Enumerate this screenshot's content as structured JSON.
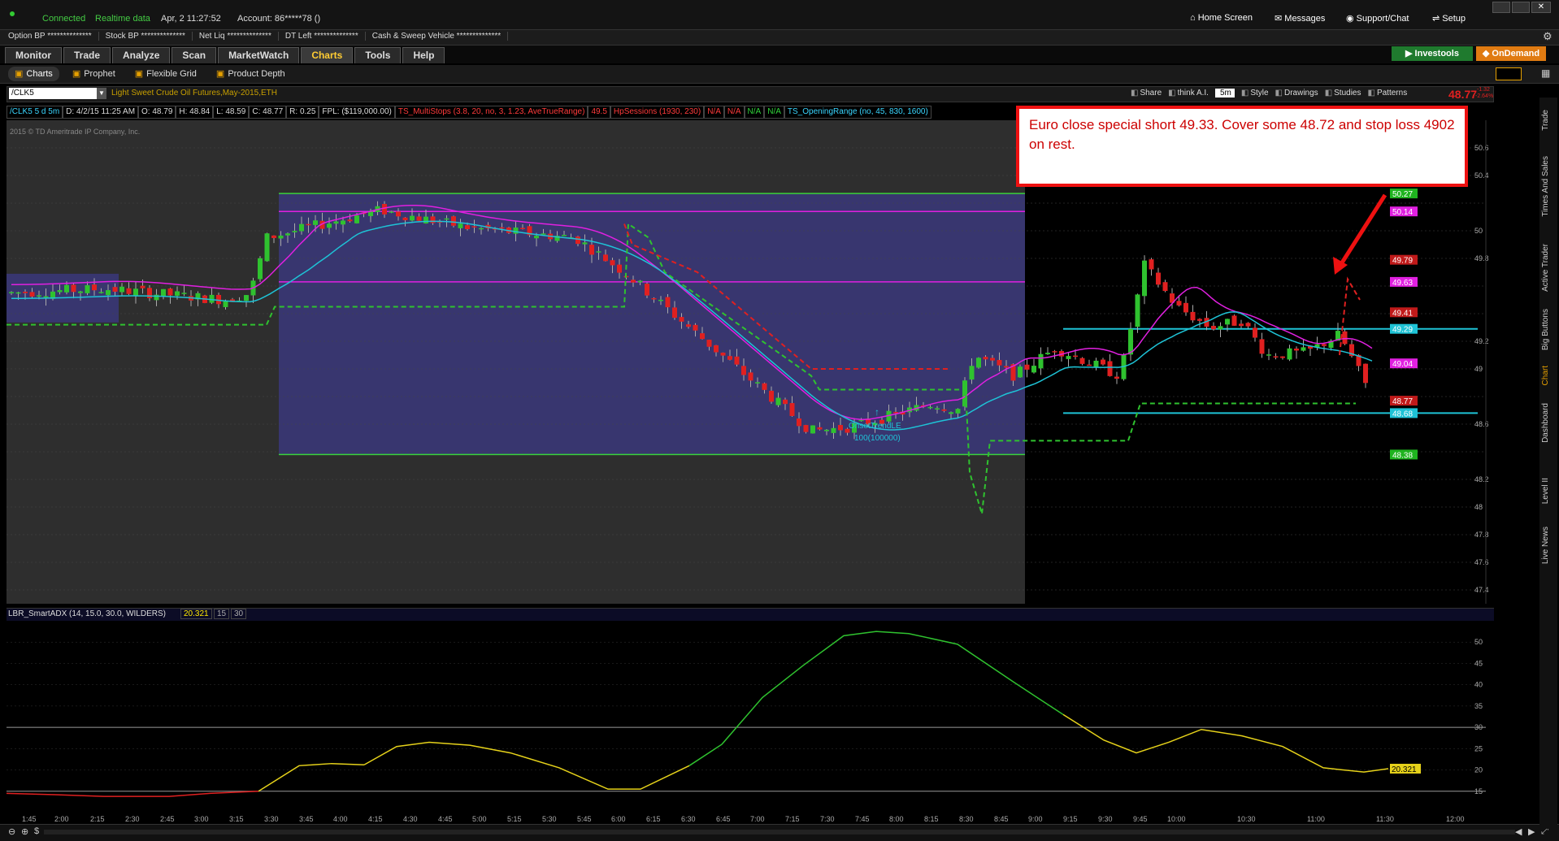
{
  "status": {
    "connected": "Connected",
    "realtime": "Realtime data",
    "datetime": "Apr, 2  11:27:52",
    "account": "Account: 86*****78 ()"
  },
  "topnav": {
    "home": "Home Screen",
    "messages": "Messages",
    "support": "Support/Chat",
    "setup": "Setup"
  },
  "balances": [
    {
      "label": "Option BP",
      "value": "**************"
    },
    {
      "label": "Stock BP",
      "value": "**************"
    },
    {
      "label": "Net Liq",
      "value": "**************"
    },
    {
      "label": "DT Left",
      "value": "**************"
    },
    {
      "label": "Cash & Sweep Vehicle",
      "value": "**************"
    }
  ],
  "tabs": [
    "Monitor",
    "Trade",
    "Analyze",
    "Scan",
    "MarketWatch",
    "Charts",
    "Tools",
    "Help"
  ],
  "brand_buttons": {
    "investools": "Investools",
    "ondemand": "OnDemand"
  },
  "subtabs": [
    "Charts",
    "Prophet",
    "Flexible Grid",
    "Product Depth"
  ],
  "chart": {
    "symbol": "/CLK5",
    "description": "Light Sweet Crude Oil Futures,May-2015,ETH",
    "tools": [
      "Share",
      "think A.I.",
      "5m",
      "Style",
      "Drawings",
      "Studies",
      "Patterns"
    ],
    "last_price": "48.77",
    "change_top": "-1.32",
    "change_bottom": "-2.64%",
    "info": [
      "/CLK5 5 d 5m",
      "D: 4/2/15 11:25 AM",
      "O: 48.79",
      "H: 48.84",
      "L: 48.59",
      "C: 48.77",
      "R: 0.25",
      "FPL: ($119,000.00)"
    ],
    "studies": [
      {
        "text": "TS_MultiStops (3.8, 20, no, 3, 1.23, AveTrueRange)",
        "color": "#ff3b3b"
      },
      {
        "text": "49.5",
        "color": "#ff3b3b"
      },
      {
        "text": "HpSessions (1930, 230)",
        "color": "#ff3b3b"
      },
      {
        "text": "N/A",
        "color": "#ff3b3b"
      },
      {
        "text": "N/A",
        "color": "#ff3b3b"
      },
      {
        "text": "N/A",
        "color": "#31d63b"
      },
      {
        "text": "N/A",
        "color": "#31d63b"
      },
      {
        "text": "TS_OpeningRange (no, 45, 830, 1600)",
        "color": "#3ad6ff"
      }
    ],
    "copyright": "2015 © TD Ameritrade IP Company, Inc.",
    "signal_label": "OnsetTrendLE",
    "signal_qty": "100(100000)",
    "y_ticks": [
      "50.6",
      "50.4",
      "50",
      "49.8",
      "49.2",
      "49",
      "48.6",
      "48.2",
      "48",
      "47.8",
      "47.6",
      "47.4"
    ],
    "price_tags": [
      {
        "text": "50.27",
        "bg": "#1fb31f"
      },
      {
        "text": "50.14",
        "bg": "#e020e0"
      },
      {
        "text": "49.79",
        "bg": "#c01a1a"
      },
      {
        "text": "49.63",
        "bg": "#e020e0"
      },
      {
        "text": "49.41",
        "bg": "#c01a1a"
      },
      {
        "text": "49.29",
        "bg": "#1ec3d6"
      },
      {
        "text": "49.04",
        "bg": "#e020e0"
      },
      {
        "text": "48.77",
        "bg": "#c01a1a"
      },
      {
        "text": "48.68",
        "bg": "#1ec3d6"
      },
      {
        "text": "48.38",
        "bg": "#1fb31f"
      }
    ]
  },
  "annotation": {
    "text": "Euro close special short 49.33. Cover some 48.72 and stop loss 4902 on rest."
  },
  "adx": {
    "header": "LBR_SmartADX (14, 15.0, 30.0, WILDERS)",
    "value": "20.321",
    "levels": [
      "15",
      "30"
    ],
    "y_ticks": [
      "50",
      "45",
      "40",
      "35",
      "30",
      "25",
      "20",
      "15"
    ]
  },
  "time_ticks": [
    "1:45",
    "2:00",
    "2:15",
    "2:30",
    "2:45",
    "3:00",
    "3:15",
    "3:30",
    "3:45",
    "4:00",
    "4:15",
    "4:30",
    "4:45",
    "5:00",
    "5:15",
    "5:30",
    "5:45",
    "6:00",
    "6:15",
    "6:30",
    "6:45",
    "7:00",
    "7:15",
    "7:30",
    "7:45",
    "8:00",
    "8:15",
    "8:30",
    "8:45",
    "9:00",
    "9:15",
    "9:30",
    "9:45",
    "10:00",
    "10:30",
    "11:00",
    "11:30",
    "12:00"
  ],
  "right_rail": [
    "Trade",
    "Times And Sales",
    "Active Trader",
    "Big Buttons",
    "Chart",
    "Dashboard",
    "Level II",
    "Live News"
  ],
  "chart_data": {
    "type": "candlestick",
    "symbol": "/CLK5",
    "interval": "5m",
    "ohlc_last": {
      "open": 48.79,
      "high": 48.84,
      "low": 48.59,
      "close": 48.77
    },
    "opening_range": {
      "high": 49.29,
      "low": 48.68
    },
    "ylim": [
      47.3,
      50.8
    ]
  }
}
